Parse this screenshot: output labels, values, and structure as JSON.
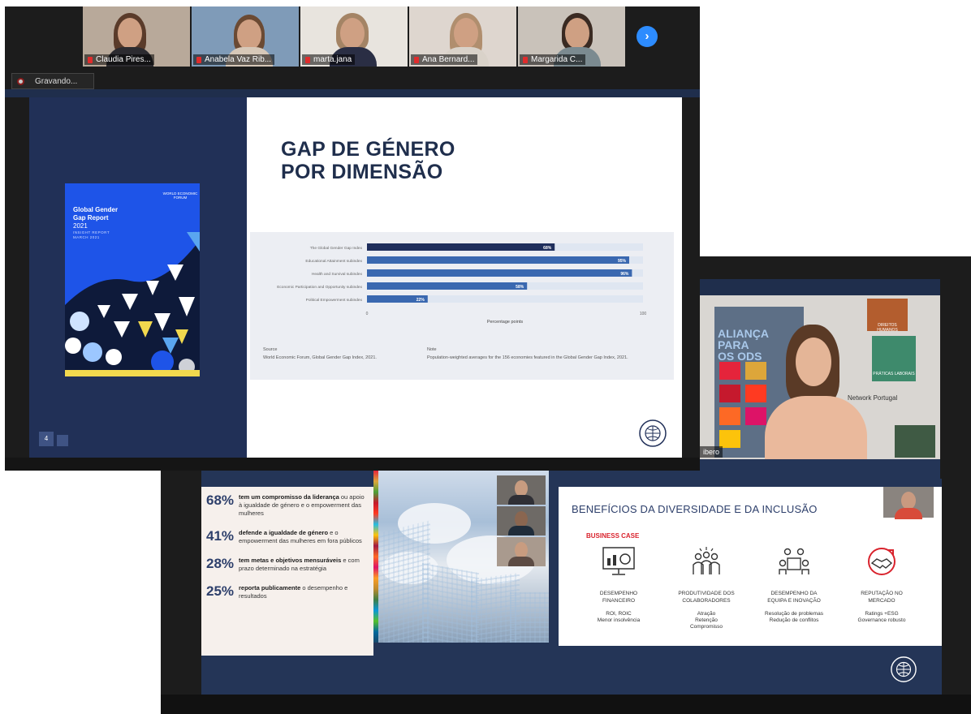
{
  "participants": [
    {
      "name": "Claudia Pires...",
      "bg": "#b8a99a",
      "torso": "#2c2b30",
      "hair": "#5a3b2a"
    },
    {
      "name": "Anabela Vaz Rib...",
      "bg": "#7f9bb8",
      "torso": "#d7c8b8",
      "hair": "#6b4a33"
    },
    {
      "name": "marta.jana",
      "bg": "#e8e4de",
      "torso": "#2a2e44",
      "hair": "#a48465"
    },
    {
      "name": "Ana Bernard...",
      "bg": "#ded6cf",
      "torso": "#d9d2c9",
      "hair": "#b08e6e"
    },
    {
      "name": "Margarida C...",
      "bg": "#c9c2ba",
      "torso": "#7b8a90",
      "hair": "#3a2a22"
    }
  ],
  "next_button": "›",
  "recording": {
    "label": "Gravando..."
  },
  "front_slide": {
    "title_line1": "GAP DE GÉNERO",
    "title_line2": "POR DIMENSÃO",
    "page_number": "4",
    "cover": {
      "wef": "WORLD ECONOMIC FORUM",
      "title_line1": "Global Gender",
      "title_line2": "Gap Report",
      "title_line3": "2021",
      "sub_line1": "INSIGHT REPORT",
      "sub_line2": "MARCH 2021"
    },
    "source_label": "Source",
    "source_text": "World Economic Forum, Global Gender Gap Index, 2021.",
    "note_label": "Note",
    "note_text": "Population-weighted averages for the 156 economies featured in the Global Gender Gap Index, 2021."
  },
  "chart_data": {
    "type": "bar",
    "orientation": "horizontal",
    "categories": [
      "The Global Gender Gap Index",
      "Educational Attainment subindex",
      "Health and Survival subindex",
      "Economic Participation and Opportunity subindex",
      "Political Empowerment subindex"
    ],
    "values": [
      68,
      95,
      96,
      58,
      22
    ],
    "value_labels": [
      "68%",
      "95%",
      "96%",
      "58%",
      "22%"
    ],
    "xlabel": "Percentage points",
    "xlim": [
      0,
      100
    ],
    "x_ticks": [
      "0",
      "100"
    ],
    "colors": {
      "highlight": "#1f2e5c",
      "bar": "#3a68b0",
      "track": "#dfe6f1"
    }
  },
  "back_slide": {
    "stats": [
      {
        "pct": "68%",
        "bold": "tem um compromisso da liderança",
        "rest": " ou apoio à igualdade de género e o empowerment das mulheres"
      },
      {
        "pct": "41%",
        "bold": "defende a igualdade de género",
        "rest": " e o empowerment das mulheres em fora públicos"
      },
      {
        "pct": "28%",
        "bold": "tem metas e objetivos mensuráveis",
        "rest": " e com prazo determinado na estratégia"
      },
      {
        "pct": "25%",
        "bold": "reporta publicamente",
        "rest": " o desempenho e resultados"
      }
    ],
    "benefits_title": "BENEFÍCIOS DA DIVERSIDADE E DA INCLUSÃO",
    "business_case": "BUSINESS CASE",
    "columns": [
      {
        "head1": "DESEMPENHO",
        "head2": "FINANCEIRO",
        "sub1": "ROI, ROIC",
        "sub2": "Menor insolvência",
        "sub3": ""
      },
      {
        "head1": "PRODUTIVIDADE DOS",
        "head2": "COLABORADORES",
        "sub1": "Atração",
        "sub2": "Retenção",
        "sub3": "Compromisso"
      },
      {
        "head1": "DESEMPENHO DA",
        "head2": "EQUIPA E INOVAÇÃO",
        "sub1": "Resolução de problemas",
        "sub2": "Redução de conflitos",
        "sub3": ""
      },
      {
        "head1": "REPUTAÇÃO NO",
        "head2": "MERCADO",
        "sub1": "Ratings +ESG",
        "sub2": "Governance robusto",
        "sub3": ""
      }
    ]
  },
  "webcam": {
    "name_tag": "ibero",
    "poster_line1": "ALIANÇA",
    "poster_line2": "PARA",
    "poster_line3": "OS ODS",
    "network": "Network Portugal",
    "sign1": "PRÁTICAS LABORAIS",
    "sign2": "DIREITOS HUMANOS"
  }
}
